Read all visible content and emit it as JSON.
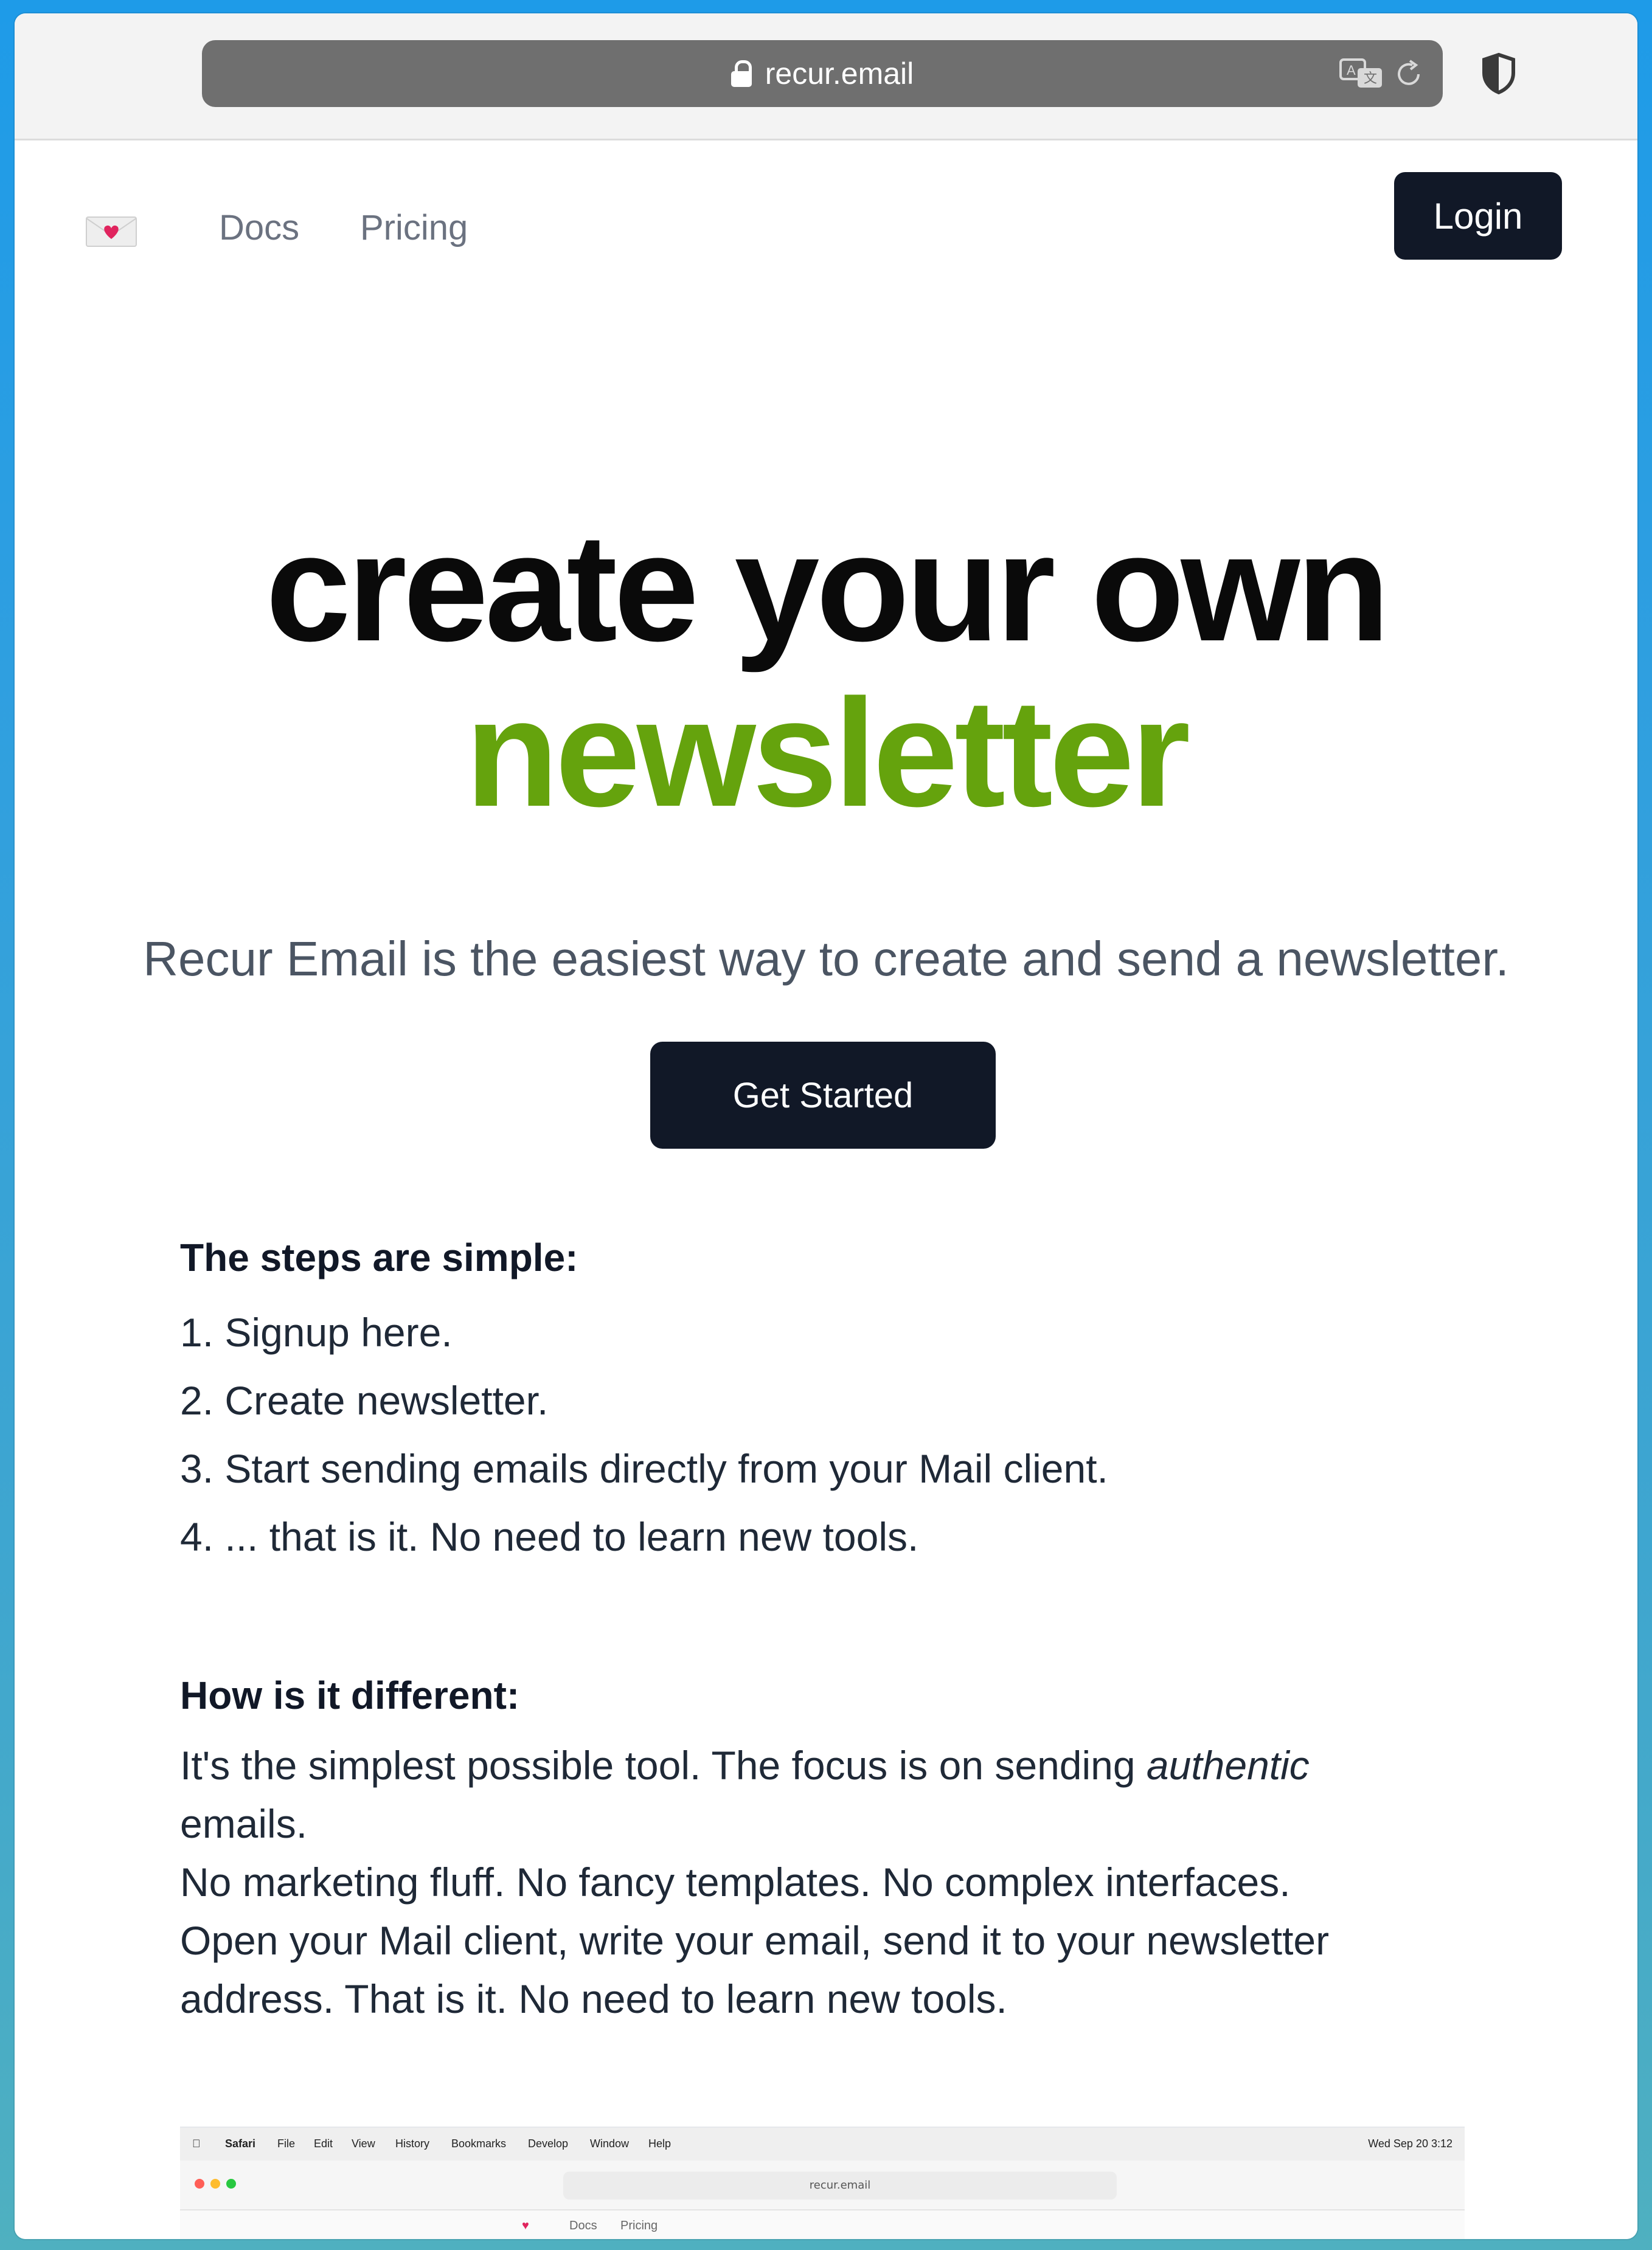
{
  "browser": {
    "url": "recur.email"
  },
  "nav": {
    "logo": "envelope-heart",
    "links": [
      "Docs",
      "Pricing"
    ],
    "login_label": "Login"
  },
  "hero": {
    "line1": "create your own",
    "line2": "newsletter",
    "accent_color": "#65a30d",
    "subtitle": "Recur Email is the easiest way to create and send a newsletter.",
    "cta_label": "Get Started"
  },
  "steps": {
    "heading": "The steps are simple:",
    "items": [
      "1. Signup here.",
      "2. Create newsletter.",
      "3. Start sending emails directly from your Mail client.",
      "4. ... that is it. No need to learn new tools."
    ]
  },
  "difference": {
    "heading": "How is it different:",
    "para1_before": "It's the simplest possible tool. The focus is on sending ",
    "para1_emph": "authentic",
    "para1_after": "emails.",
    "para2": "No marketing fluff. No fancy templates. No complex interfaces.",
    "para3": "Open your Mail client, write your email, send it to your newsletter address. That is it. No need to learn new tools."
  },
  "embedded_screenshot": {
    "menubar": [
      "Safari",
      "File",
      "Edit",
      "View",
      "History",
      "Bookmarks",
      "Develop",
      "Window",
      "Help"
    ],
    "clock": "Wed Sep 20  3:12",
    "url": "recur.email",
    "nav_links": [
      "Docs",
      "Pricing"
    ]
  }
}
